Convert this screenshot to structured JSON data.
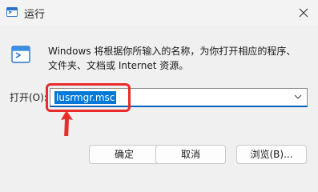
{
  "window": {
    "title": "运行"
  },
  "description": {
    "line1": "Windows 将根据你所输入的名称，为你打开相应的程序、",
    "line2": "文件夹、文档或 Internet 资源。"
  },
  "open_field": {
    "label": "打开(O):",
    "value": "lusrmgr.msc"
  },
  "buttons": {
    "ok": "确定",
    "cancel": "取消",
    "browse": "浏览(B)..."
  },
  "colors": {
    "annotation": "#ea2b2b",
    "selection": "#0078d7",
    "focus": "#005fb8"
  },
  "icons": {
    "title": "run-app-icon",
    "close": "close-icon",
    "body": "run-window-icon",
    "dropdown": "chevron-down-icon"
  }
}
